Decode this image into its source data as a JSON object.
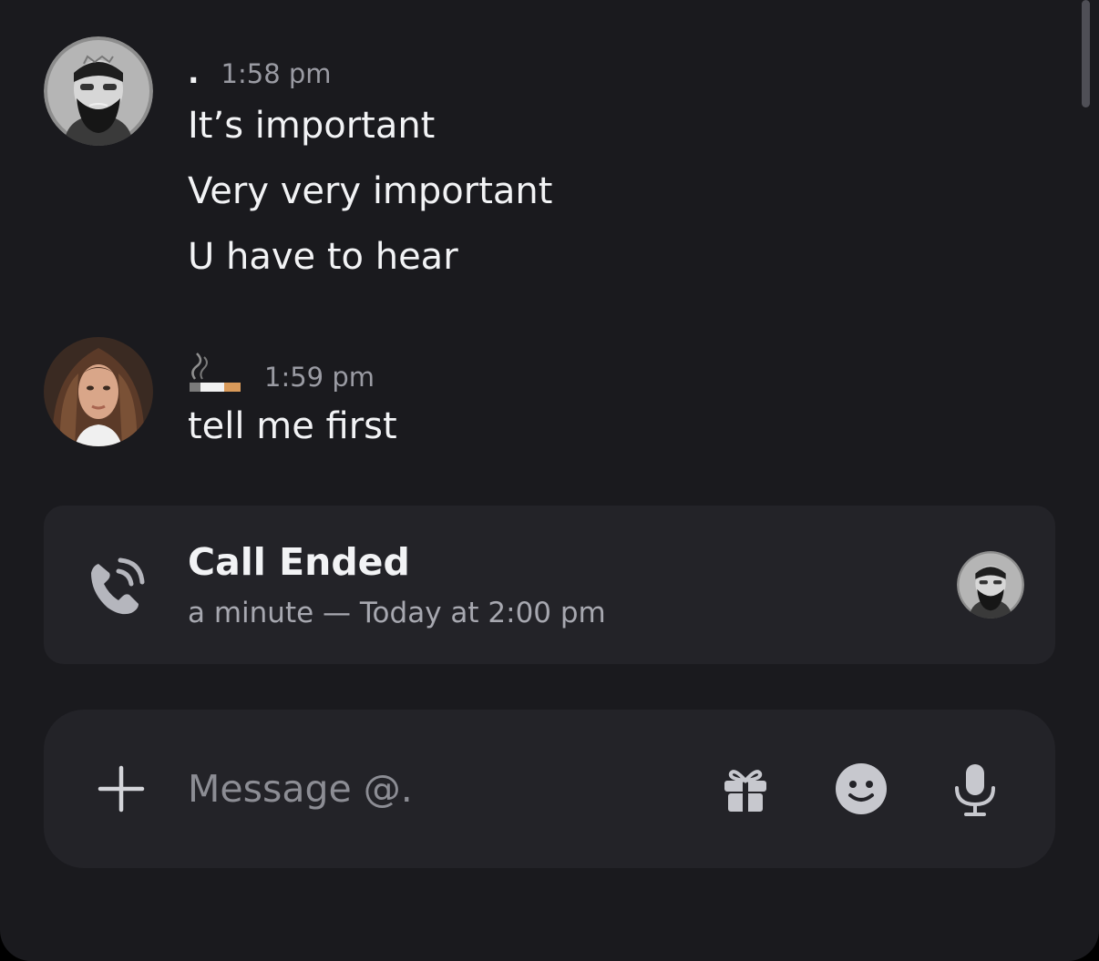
{
  "messages": [
    {
      "username": ".",
      "timestamp": "1:58 pm",
      "avatar_icon": "bearded-man-avatar",
      "lines": [
        "It’s important",
        "Very very important",
        "U have to hear"
      ]
    },
    {
      "username_icon": "cigarette-emoji",
      "timestamp": "1:59 pm",
      "avatar_icon": "woman-portrait-avatar",
      "lines": [
        "tell me first"
      ]
    }
  ],
  "call": {
    "title": "Call Ended",
    "subtitle": "a minute — Today at 2:00 pm",
    "icon": "phone-call-icon",
    "participant_icon": "bearded-man-avatar"
  },
  "composer": {
    "placeholder": "Message @.",
    "icons": [
      "plus-icon",
      "gift-icon",
      "emoji-icon",
      "microphone-icon"
    ]
  },
  "colors": {
    "background": "#1a1a1e",
    "card": "#232328",
    "text": "#f2f3f5",
    "muted": "#9a9ba3"
  }
}
